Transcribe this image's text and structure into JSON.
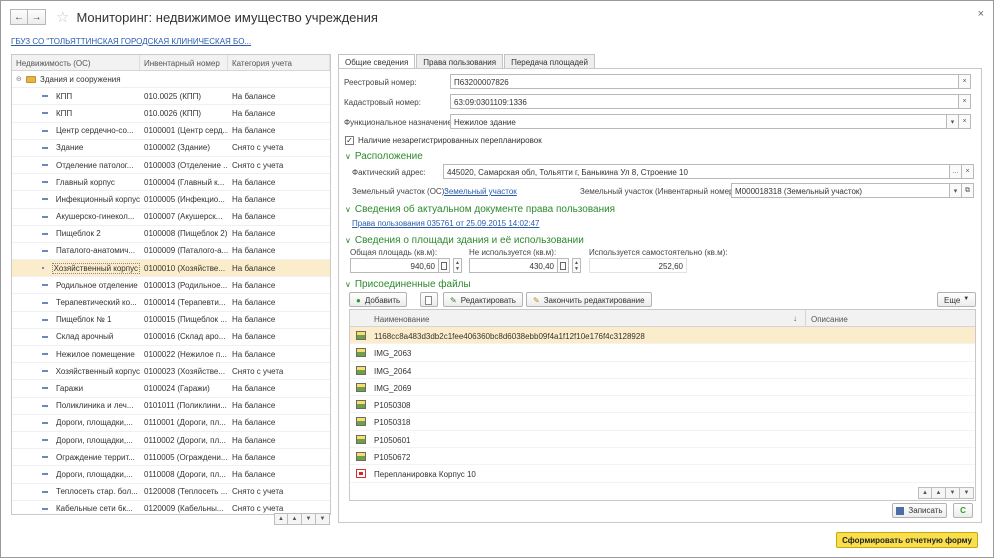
{
  "window": {
    "title": "Мониторинг: недвижимое имущество учреждения",
    "org_link": "ГБУЗ СО \"ТОЛЬЯТТИНСКАЯ ГОРОДСКАЯ КЛИНИЧЕСКАЯ БО..."
  },
  "icons": {
    "back": "←",
    "forward": "→",
    "star": "☆",
    "close": "×"
  },
  "tree": {
    "columns": [
      "Недвижимость (ОС)",
      "Инвентарный номер",
      "Категория учета"
    ],
    "group": "Здания и сооружения",
    "rows": [
      {
        "name": "КПП",
        "inv": "010.0025 (КПП)",
        "cat": "На балансе"
      },
      {
        "name": "КПП",
        "inv": "010.0026 (КПП)",
        "cat": "На балансе"
      },
      {
        "name": "Центр сердечно-со...",
        "inv": "0100001 (Центр серд...",
        "cat": "На балансе"
      },
      {
        "name": "Здание",
        "inv": "0100002 (Здание)",
        "cat": "Снято с учета"
      },
      {
        "name": "Отделение патолог...",
        "inv": "0100003 (Отделение ...",
        "cat": "Снято с учета"
      },
      {
        "name": "Главный корпус",
        "inv": "0100004 (Главный к...",
        "cat": "На балансе"
      },
      {
        "name": "Инфекционный корпус",
        "inv": "0100005 (Инфекцио...",
        "cat": "На балансе"
      },
      {
        "name": "Акушерско-гинекол...",
        "inv": "0100007 (Акушерск...",
        "cat": "На балансе"
      },
      {
        "name": "Пищеблок 2",
        "inv": "0100008 (Пищеблок 2)",
        "cat": "На балансе"
      },
      {
        "name": "Паталого-анатомич...",
        "inv": "0100009 (Паталого-а...",
        "cat": "На балансе"
      },
      {
        "name": "Хозяйственный корпус",
        "inv": "0100010 (Хозяйстве...",
        "cat": "На балансе",
        "selected": true
      },
      {
        "name": "Родильное отделение",
        "inv": "0100013 (Родильное...",
        "cat": "На балансе"
      },
      {
        "name": "Терапевтический ко...",
        "inv": "0100014 (Терапевти...",
        "cat": "На балансе"
      },
      {
        "name": "Пищеблок № 1",
        "inv": "0100015 (Пищеблок ...",
        "cat": "На балансе"
      },
      {
        "name": "Склад арочный",
        "inv": "0100016 (Склад аро...",
        "cat": "На балансе"
      },
      {
        "name": "Нежилое помещение",
        "inv": "0100022 (Нежилое п...",
        "cat": "На балансе"
      },
      {
        "name": "Хозяйственный корпус",
        "inv": "0100023 (Хозяйстве...",
        "cat": "Снято с учета"
      },
      {
        "name": "Гаражи",
        "inv": "0100024 (Гаражи)",
        "cat": "На балансе"
      },
      {
        "name": "Поликлиника и леч...",
        "inv": "0101011 (Поликлини...",
        "cat": "На балансе"
      },
      {
        "name": "Дороги, площадки,...",
        "inv": "0110001 (Дороги, пл...",
        "cat": "На балансе"
      },
      {
        "name": "Дороги, площадки,...",
        "inv": "0110002 (Дороги, пл...",
        "cat": "На балансе"
      },
      {
        "name": "Ограждение террит...",
        "inv": "0110005 (Ограждени...",
        "cat": "На балансе"
      },
      {
        "name": "Дороги, площадки,...",
        "inv": "0110008 (Дороги, пл...",
        "cat": "На балансе"
      },
      {
        "name": "Теплосеть стар. бол...",
        "inv": "0120008 (Теплосеть ...",
        "cat": "Снято с учета"
      },
      {
        "name": "Кабельные сети 6к...",
        "inv": "0120009 (Кабельны...",
        "cat": "Снято с учета"
      }
    ],
    "nav": [
      "▲",
      "▲",
      "▼",
      "▼"
    ]
  },
  "tabs": [
    "Общие сведения",
    "Права пользования",
    "Передача площадей"
  ],
  "form": {
    "reg_label": "Реестровый номер:",
    "reg_value": "П63200007826",
    "cad_label": "Кадастровый номер:",
    "cad_value": "63:09:0301109:1336",
    "func_label": "Функциональное назначение:",
    "func_value": "Нежилое здание",
    "unreg_label": "Наличие незарегистрированных перепланировок",
    "unreg_checked": true
  },
  "location": {
    "header": "Расположение",
    "addr_label": "Фактический адрес:",
    "addr_value": "445020, Самарская обл, Тольятти г, Баныкина Ул 8, Строение 10",
    "land_os_label": "Земельный участок (ОС):",
    "land_os_link": "Земельный участок",
    "land_inv_label": "Земельный участок (Инвентарный номер):",
    "land_inv_value": "М000018318 (Земельный участок)"
  },
  "rights": {
    "header": "Сведения об актуальном документе права пользования",
    "doc_link": "Права пользования 035761 от 25.09.2015 14:02:47"
  },
  "area": {
    "header": "Сведения о площади здания и её использовании",
    "total_label": "Общая площадь (кв.м):",
    "total_value": "940,60",
    "unused_label": "Не используется (кв.м):",
    "unused_value": "430,40",
    "self_label": "Используется самостоятельно (кв.м):",
    "self_value": "252,60"
  },
  "files": {
    "header": "Присоединенные файлы",
    "add_label": "Добавить",
    "edit_label": "Редактировать",
    "finish_label": "Закончить редактирование",
    "more_label": "Еще",
    "col_name": "Наименование",
    "col_desc": "Описание",
    "rows": [
      {
        "name": "1168cc8a483d3db2c1fee406360bc8d6038ebb09f4a1f12f10e176f4c3128928",
        "type": "image",
        "selected": true
      },
      {
        "name": "IMG_2063",
        "type": "image"
      },
      {
        "name": "IMG_2064",
        "type": "image"
      },
      {
        "name": "IMG_2069",
        "type": "image"
      },
      {
        "name": "P1050308",
        "type": "image"
      },
      {
        "name": "P1050318",
        "type": "image"
      },
      {
        "name": "P1050601",
        "type": "image"
      },
      {
        "name": "P1050672",
        "type": "image"
      },
      {
        "name": "Перепланировка Корпус 10",
        "type": "pdf"
      }
    ]
  },
  "actions": {
    "save_label": "Записать",
    "refresh_label": "C",
    "report_label": "Сформировать отчетную форму"
  },
  "colors": {
    "section_green": "#2d8a2d",
    "selection": "#fbeccb",
    "report_button": "#f8df4b",
    "link": "#2a5cad"
  }
}
